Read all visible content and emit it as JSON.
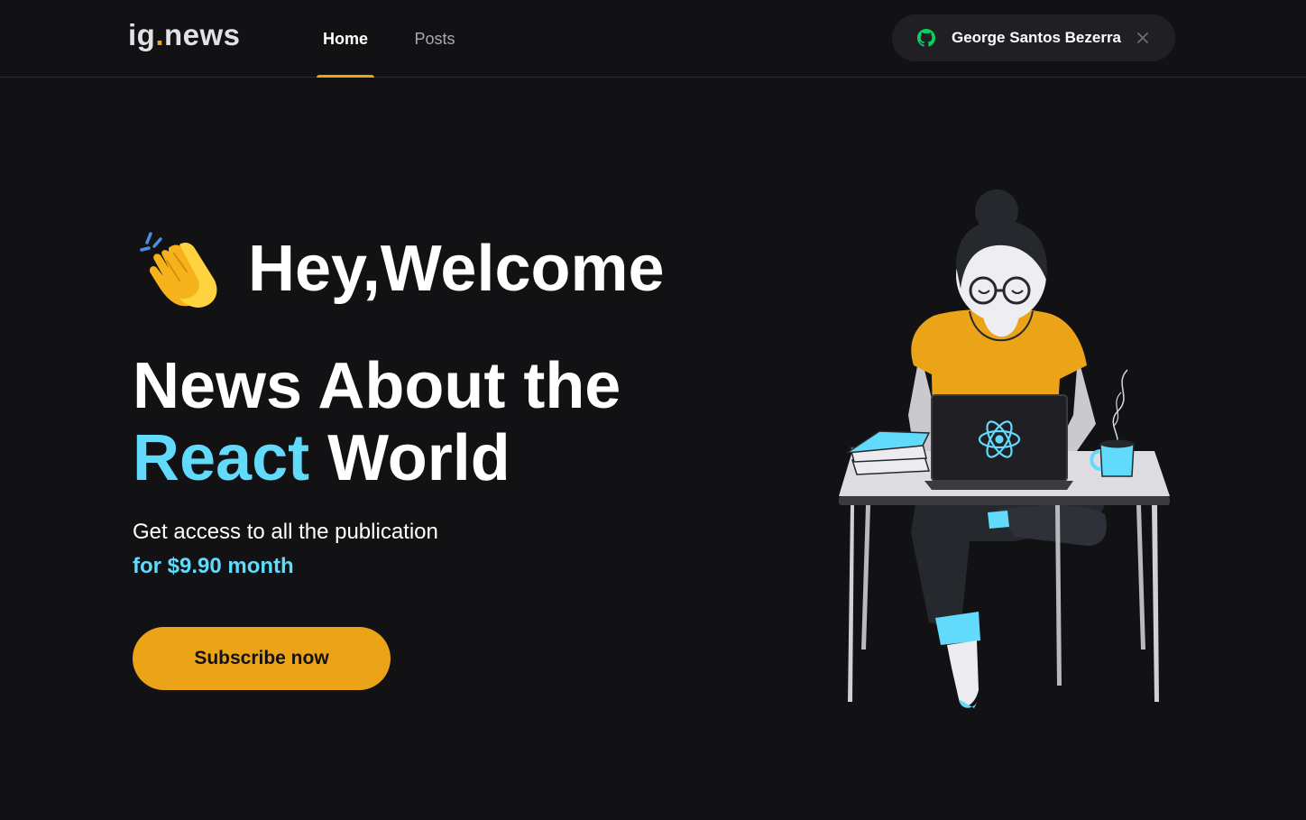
{
  "header": {
    "logo_text": "ig",
    "logo_dot": ".",
    "logo_suffix": "news",
    "nav": {
      "home_label": "Home",
      "posts_label": "Posts",
      "active": "Home"
    },
    "user": {
      "name": "George Santos Bezerra",
      "provider_icon": "github-icon",
      "close_icon": "close-icon"
    }
  },
  "hero": {
    "emoji_icon": "clapping-hands-icon",
    "greeting": "Hey,Welcome",
    "headline_part1": "News About the",
    "headline_accent": "React",
    "headline_part2": "World",
    "subtitle": "Get access to all the publication",
    "price": "for $9.90 month",
    "cta_label": "Subscribe now",
    "illustration_icon": "woman-with-laptop-illustration"
  },
  "colors": {
    "background": "#121214",
    "header_border": "#29292e",
    "accent_yellow": "#eba417",
    "accent_cyan": "#61dafb",
    "pill_bg": "#202024",
    "github_green": "#04d361"
  }
}
